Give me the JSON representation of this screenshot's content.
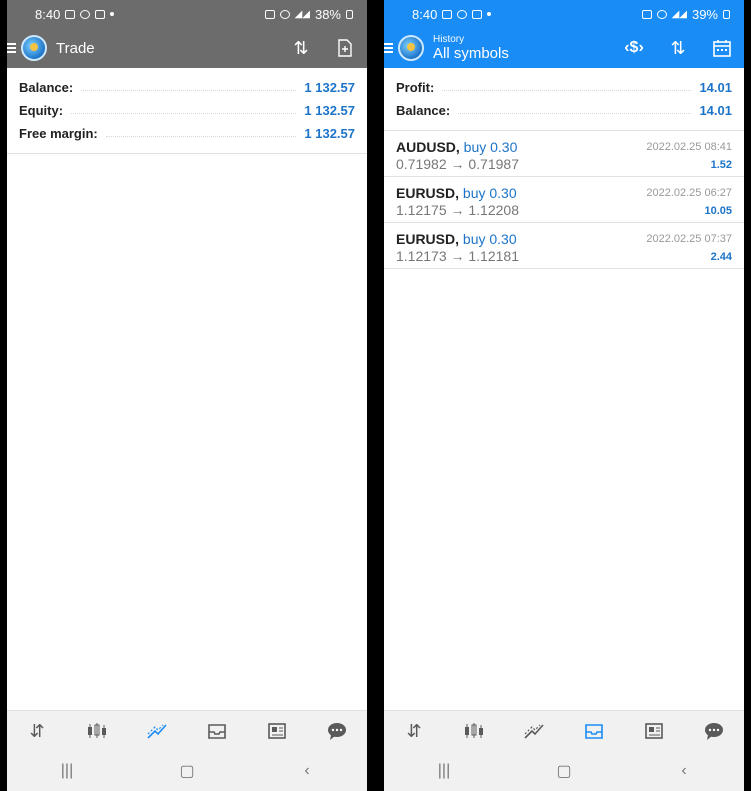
{
  "left": {
    "status": {
      "time": "8:40",
      "battery": "38%"
    },
    "appbar": {
      "title": "Trade"
    },
    "summary": [
      {
        "label": "Balance:",
        "value": "1 132.57"
      },
      {
        "label": "Equity:",
        "value": "1 132.57"
      },
      {
        "label": "Free margin:",
        "value": "1 132.57"
      }
    ],
    "active_nav": "trade"
  },
  "right": {
    "status": {
      "time": "8:40",
      "battery": "39%"
    },
    "appbar": {
      "subtitle": "History",
      "title": "All symbols"
    },
    "summary": [
      {
        "label": "Profit:",
        "value": "14.01"
      },
      {
        "label": "Balance:",
        "value": "14.01"
      }
    ],
    "deals": [
      {
        "symbol": "AUDUSD,",
        "side": "buy 0.30",
        "prices": "0.71982 → 0.71987",
        "time": "2022.02.25 08:41",
        "profit": "1.52"
      },
      {
        "symbol": "EURUSD,",
        "side": "buy 0.30",
        "prices": "1.12175 → 1.12208",
        "time": "2022.02.25 06:27",
        "profit": "10.05"
      },
      {
        "symbol": "EURUSD,",
        "side": "buy 0.30",
        "prices": "1.12173 → 1.12181",
        "time": "2022.02.25 07:37",
        "profit": "2.44"
      }
    ],
    "active_nav": "history"
  },
  "icons": {
    "nav": [
      "quotes-icon",
      "chart-icon",
      "trade-icon",
      "history-icon",
      "news-icon",
      "chat-icon"
    ],
    "system": [
      "recents-icon",
      "home-icon",
      "back-icon"
    ]
  },
  "colors": {
    "accent": "#1a8cf5",
    "value_blue": "#1d74c9",
    "appbar_gray": "#6c6c6c"
  }
}
